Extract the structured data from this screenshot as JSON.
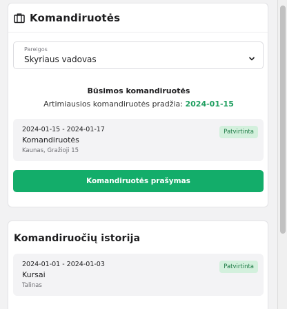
{
  "trips_card": {
    "title": "Komandiruotės",
    "position_select": {
      "label": "Pareigos",
      "value": "Skyriaus vadovas"
    },
    "upcoming_title": "Būsimos komandiruotės",
    "upcoming_subtitle": "Artimiausios komandiruotės pradžia:",
    "upcoming_date": "2024-01-15",
    "upcoming_trip": {
      "dates": "2024-01-15 - 2024-01-17",
      "name": "Komandiruotės",
      "place": "Kaunas, Gražioji 15",
      "status": "Patvirtinta"
    },
    "request_button": "Komandiruotės prašymas"
  },
  "history_card": {
    "title": "Komandiruočių istorija",
    "trips": [
      {
        "dates": "2024-01-01 - 2024-01-03",
        "name": "Kursai",
        "place": "Talinas",
        "status": "Patvirtinta"
      }
    ]
  },
  "colors": {
    "accent": "#13ad6a",
    "accent_text": "#1e9e5f",
    "badge_bg": "#d3f0dd",
    "badge_text": "#1d7a45"
  },
  "icons": {
    "header": "briefcase-icon",
    "select": "chevron-down-icon"
  }
}
